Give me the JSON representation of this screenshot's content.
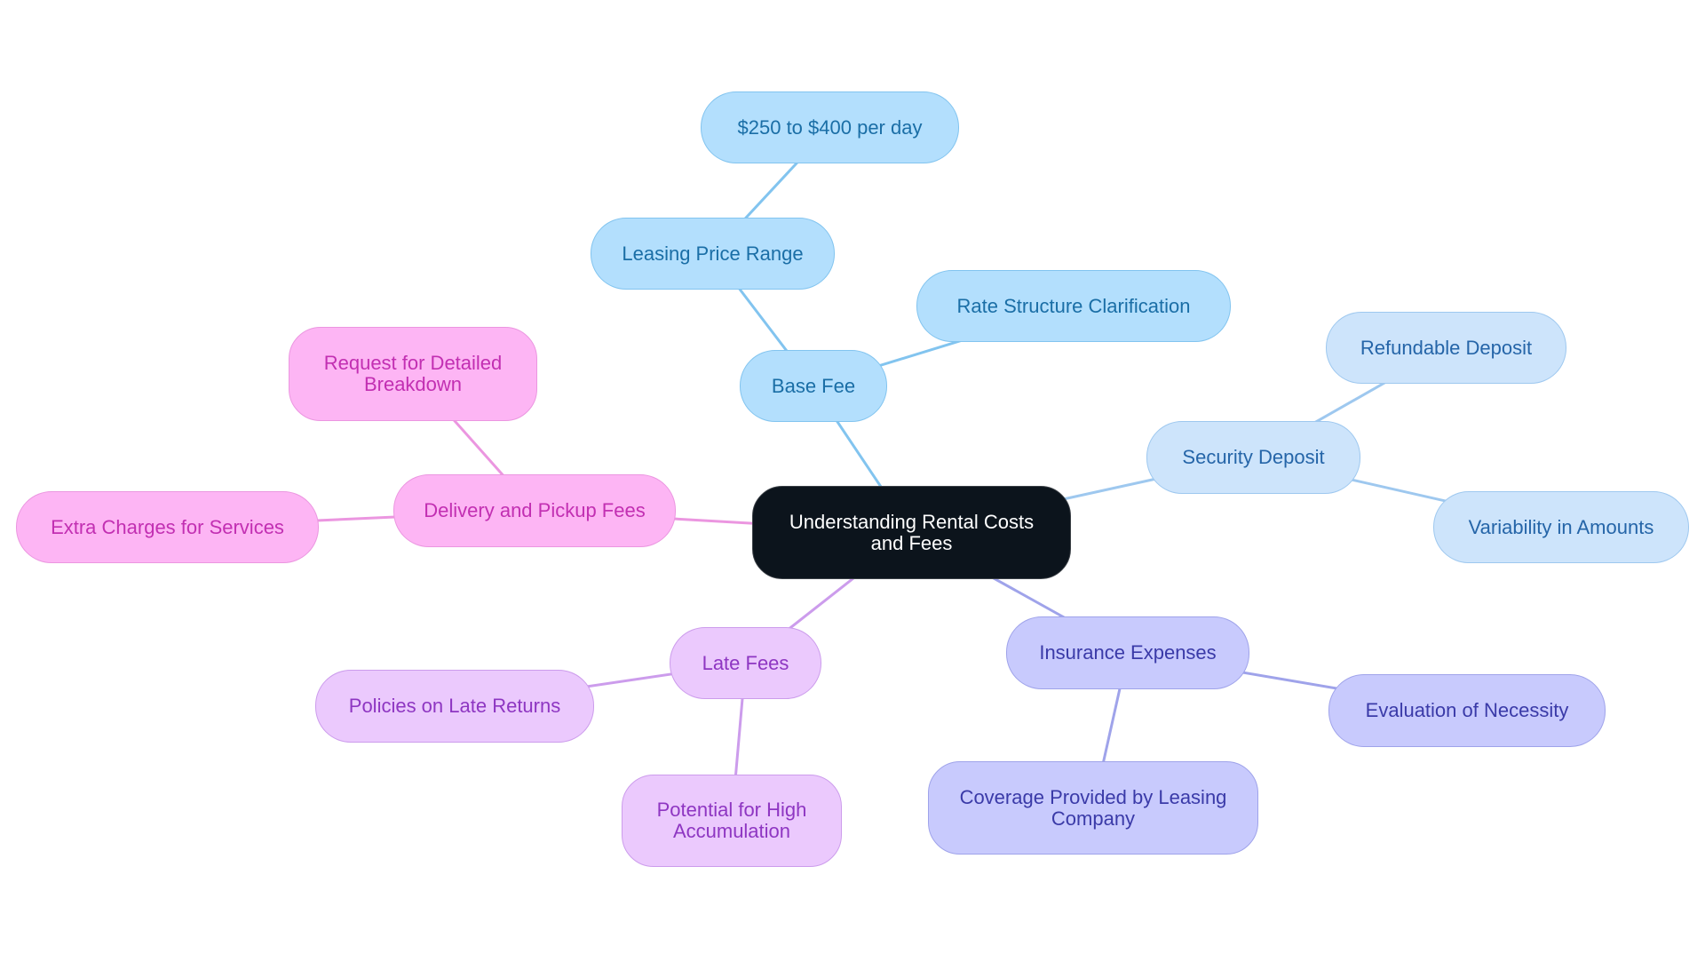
{
  "diagram": {
    "type": "mind-map",
    "root": {
      "id": "root",
      "label": "Understanding Rental Costs\nand Fees"
    },
    "branches": [
      {
        "id": "base",
        "label": "Base Fee",
        "color_fill": "#b3dffd",
        "color_edge": "#82c4ef",
        "color_text": "#1a6ea6",
        "children": [
          {
            "id": "leasing",
            "label": "Leasing Price Range",
            "children": [
              {
                "id": "price",
                "label": "$250 to $400 per day"
              }
            ]
          },
          {
            "id": "rate",
            "label": "Rate Structure Clarification"
          }
        ]
      },
      {
        "id": "security",
        "label": "Security Deposit",
        "color_fill": "#cde4fb",
        "color_edge": "#9ec8ef",
        "color_text": "#2565a8",
        "children": [
          {
            "id": "refund",
            "label": "Refundable Deposit"
          },
          {
            "id": "variability",
            "label": "Variability in Amounts"
          }
        ]
      },
      {
        "id": "insurance",
        "label": "Insurance Expenses",
        "color_fill": "#c8cafd",
        "color_edge": "#9fa3ea",
        "color_text": "#3a3aa8",
        "children": [
          {
            "id": "evaluation",
            "label": "Evaluation of Necessity"
          },
          {
            "id": "coverage",
            "label": "Coverage Provided by Leasing\nCompany"
          }
        ]
      },
      {
        "id": "late",
        "label": "Late Fees",
        "color_fill": "#ebc9fd",
        "color_edge": "#cc9cec",
        "color_text": "#8e36c2",
        "children": [
          {
            "id": "policies",
            "label": "Policies on Late Returns"
          },
          {
            "id": "potential",
            "label": "Potential for High\nAccumulation"
          }
        ]
      },
      {
        "id": "delivery",
        "label": "Delivery and Pickup Fees",
        "color_fill": "#fdb5f4",
        "color_edge": "#eb96e0",
        "color_text": "#c22fb2",
        "children": [
          {
            "id": "request",
            "label": "Request for Detailed\nBreakdown"
          },
          {
            "id": "extra",
            "label": "Extra Charges for Services"
          }
        ]
      }
    ],
    "root_color": "#0c141c",
    "root_text_color": "#ffffff"
  }
}
